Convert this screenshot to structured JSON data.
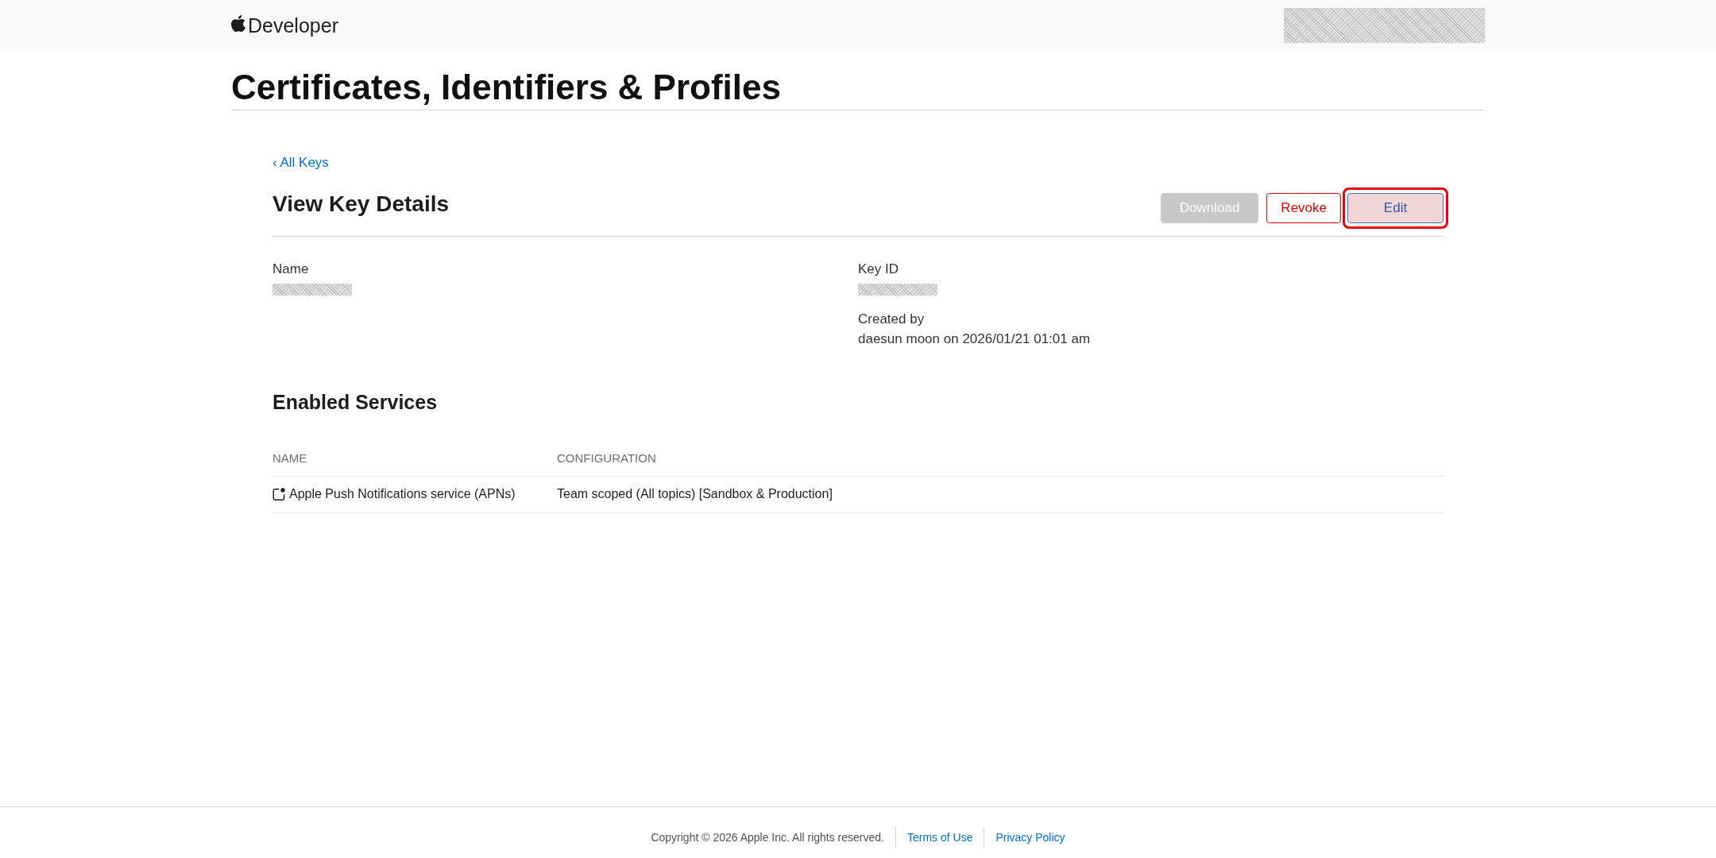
{
  "header": {
    "brand": "Developer",
    "account_redacted": true
  },
  "page_title": "Certificates, Identifiers & Profiles",
  "back_link": "‹ All Keys",
  "heading": "View Key Details",
  "buttons": [
    {
      "label": "Download",
      "kind": "filled",
      "disabled": true,
      "highlighted": false
    },
    {
      "label": "Revoke",
      "kind": "destructive",
      "disabled": false,
      "highlighted": false
    },
    {
      "label": "Edit",
      "kind": "outline",
      "disabled": false,
      "highlighted": true
    }
  ],
  "detail_columns": [
    [
      {
        "label": "Name",
        "redacted": true
      }
    ],
    [
      {
        "label": "Key ID",
        "redacted": true
      },
      {
        "label": "Created by",
        "redacted": false,
        "value": "daesun moon on 2026/01/21 01:01 am"
      }
    ]
  ],
  "services": {
    "title": "Enabled Services",
    "columns": [
      "NAME",
      "CONFIGURATION"
    ],
    "rows": [
      {
        "name": "Apple Push Notifications service (APNs)",
        "configuration": "Team scoped (All topics) [Sandbox & Production]"
      }
    ]
  },
  "footer": {
    "copyright": "Copyright © 2026 Apple Inc. All rights reserved.",
    "links": [
      "Terms of Use",
      "Privacy Policy"
    ]
  }
}
